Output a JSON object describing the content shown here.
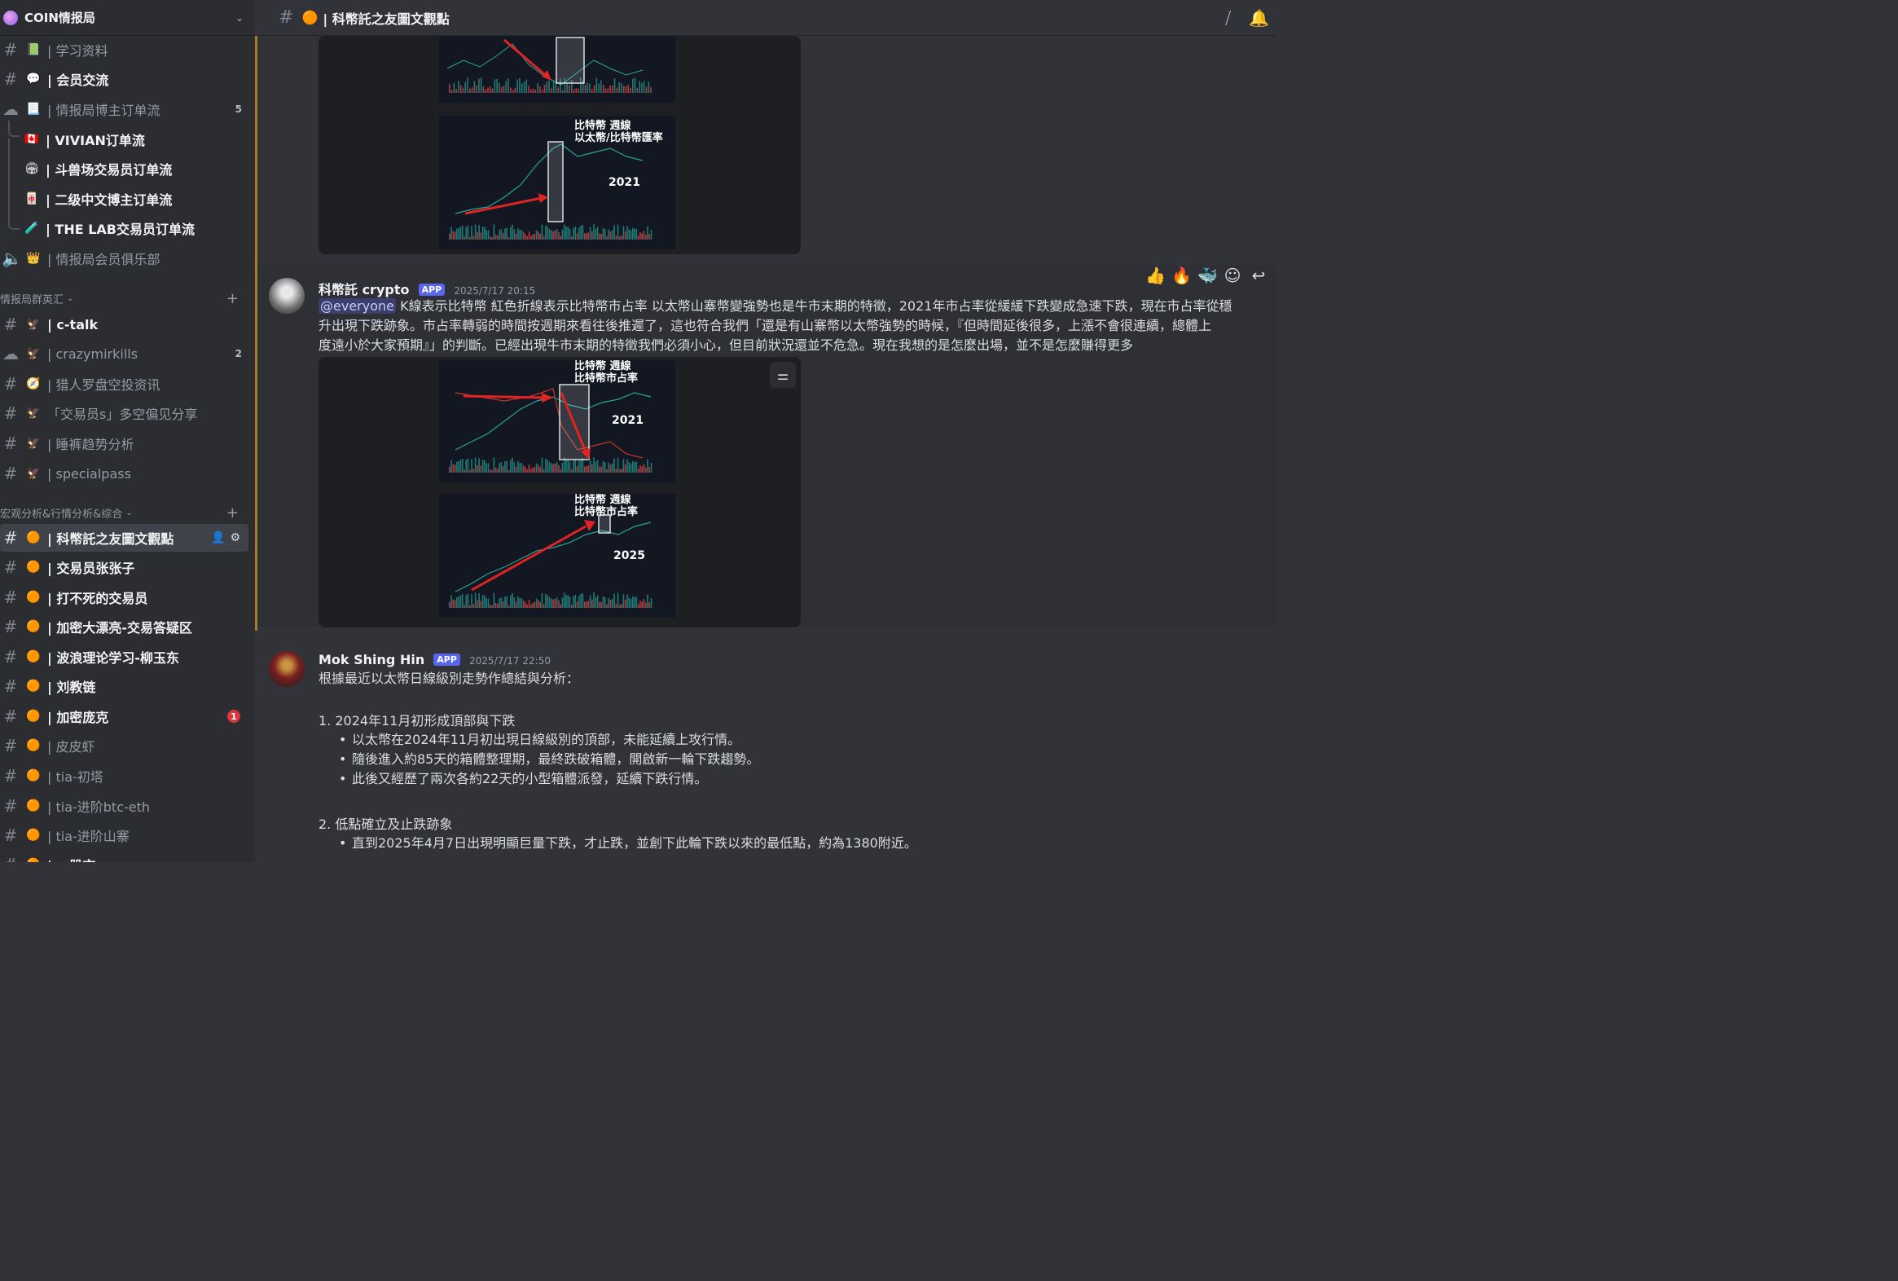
{
  "server": {
    "name": "COIN情报局"
  },
  "channels_top": [
    {
      "emoji": "📗",
      "name": "| 学习资料"
    },
    {
      "emoji": "💬",
      "name": "| 会员交流"
    },
    {
      "emoji": "📃",
      "name": "| 情报局博主订单流",
      "count": "5"
    },
    {
      "emoji": "🇨🇦",
      "name": "| VIVIAN订单流"
    },
    {
      "emoji": "🏟",
      "name": "| 斗兽场交易员订单流"
    },
    {
      "emoji": "🀄",
      "name": "| 二级中文博主订单流"
    },
    {
      "emoji": "🧪",
      "name": "| THE LAB交易员订单流"
    },
    {
      "emoji": "👑",
      "name": "| 情报局会员俱乐部"
    }
  ],
  "category1": {
    "label": "情报局群英汇"
  },
  "channels_mid": [
    {
      "emoji": "🦅",
      "name": "| c-talk"
    },
    {
      "emoji": "🦅",
      "name": "| crazymirkills",
      "count": "2"
    },
    {
      "emoji": "🧭",
      "name": "| 猎人罗盘空投资讯"
    },
    {
      "emoji": "🦅",
      "name": "「交易员s」多空偏见分享"
    },
    {
      "emoji": "🦅",
      "name": "| 睡裤趋势分析"
    },
    {
      "emoji": "🦅",
      "name": "| specialpass"
    }
  ],
  "category2": {
    "label": "宏观分析&行情分析&综合"
  },
  "channels_bottom": [
    {
      "emoji": "🟠",
      "name": "| 科幣託之友圖文觀點"
    },
    {
      "emoji": "🟠",
      "name": "| 交易员张张子"
    },
    {
      "emoji": "🟠",
      "name": "| 打不死的交易员"
    },
    {
      "emoji": "🟠",
      "name": "| 加密大漂亮-交易答疑区"
    },
    {
      "emoji": "🟠",
      "name": "| 波浪理论学习-柳玉东"
    },
    {
      "emoji": "🟠",
      "name": "| 刘教链"
    },
    {
      "emoji": "🟠",
      "name": "| 加密庞克",
      "badge": "1"
    },
    {
      "emoji": "🟠",
      "name": "| 皮皮虾"
    },
    {
      "emoji": "🟠",
      "name": "| tia-初塔"
    },
    {
      "emoji": "🟠",
      "name": "| tia-进阶btc-eth"
    },
    {
      "emoji": "🟠",
      "name": "| tia-进阶山寨"
    },
    {
      "emoji": "🟠",
      "name": "| …股市"
    }
  ],
  "topbar": {
    "title": "| 科幣託之友圖文觀點"
  },
  "chart_overlays": {
    "top_lower_title1": "比特幣  週線",
    "top_lower_title2": "以太幣/比特幣匯率",
    "top_lower_year": "2021",
    "mid_upper_title1": "比特幣  週線",
    "mid_upper_title2": "比特幣市占率",
    "mid_upper_year": "2021",
    "mid_lower_title1": "比特幣  週線",
    "mid_lower_title2": "比特幣市占率",
    "mid_lower_year": "2025"
  },
  "message1": {
    "username": "科幣託 crypto",
    "tag": "APP",
    "timestamp": "2025/7/17 20:15",
    "mention": "@everyone",
    "text_line1": " K線表示比特幣 紅色折線表示比特幣市占率 以太幣山寨幣變強勢也是牛市末期的特徵，2021年市占率從緩緩下跌變成急速下跌，現在市占率從穩",
    "text_line2": "升出現下跌跡象。市占率轉弱的時間按週期來看往後推遲了，這也符合我們「還是有山寨幣以太幣強勢的時候，『但時間延後很多，上漲不會很連續，總體上",
    "text_line3": "度遠小於大家預期』」的判斷。已經出現牛市末期的特徵我們必須小心，但目前狀況還並不危急。現在我想的是怎麼出場，並不是怎麼賺得更多"
  },
  "reactions": [
    "👍",
    "🔥",
    "🐳",
    "☺",
    "↩"
  ],
  "message2": {
    "username": "Mok Shing Hin",
    "tag": "APP",
    "timestamp": "2025/7/17 22:50",
    "intro": "根據最近以太幣日線級別走勢作總結與分析：",
    "section1_title": "1. 2024年11月初形成頂部與下跌",
    "section1_items": [
      "以太幣在2024年11月初出現日線級別的頂部，未能延續上攻行情。",
      "隨後進入約85天的箱體整理期，最終跌破箱體，開啟新一輪下跌趨勢。",
      "此後又經歷了兩次各約22天的小型箱體派發，延續下跌行情。"
    ],
    "section2_title": "2. 低點確立及止跌跡象",
    "section2_items": [
      "直到2025年4月7日出現明顯巨量下跌，才止跌，並創下此輪下跌以來的最低點，約為1380附近。"
    ]
  },
  "colors": {
    "accent": "#5865f2",
    "badge": "#da373c",
    "arrow": "#e02424",
    "candle_up": "#26a69a",
    "candle_down": "#ef5350"
  }
}
